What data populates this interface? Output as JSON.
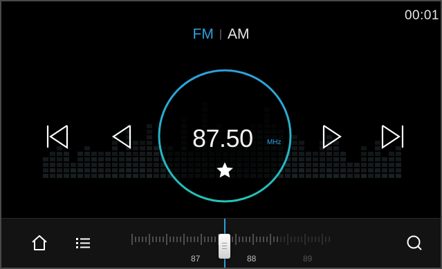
{
  "clock": "00:01",
  "bands": {
    "fm": "FM",
    "separator": "|",
    "am": "AM",
    "active": "FM"
  },
  "tuner": {
    "frequency": "87.50",
    "unit": "MHz",
    "favorite_icon": "star-icon"
  },
  "controls": {
    "seek_back_icon": "skip-previous-icon",
    "step_back_icon": "chevron-left-icon",
    "step_forward_icon": "chevron-right-icon",
    "seek_forward_icon": "skip-next-icon"
  },
  "bottom": {
    "home_icon": "home-icon",
    "list_icon": "list-icon",
    "search_icon": "search-icon",
    "scale_labels": [
      "87",
      "88",
      "89"
    ],
    "slider_value_mhz": 87.5
  },
  "colors": {
    "accent": "#2f9fdc",
    "dial_gradient_start": "#2f9fdc",
    "dial_gradient_end": "#22c4b6",
    "background": "#000000"
  }
}
